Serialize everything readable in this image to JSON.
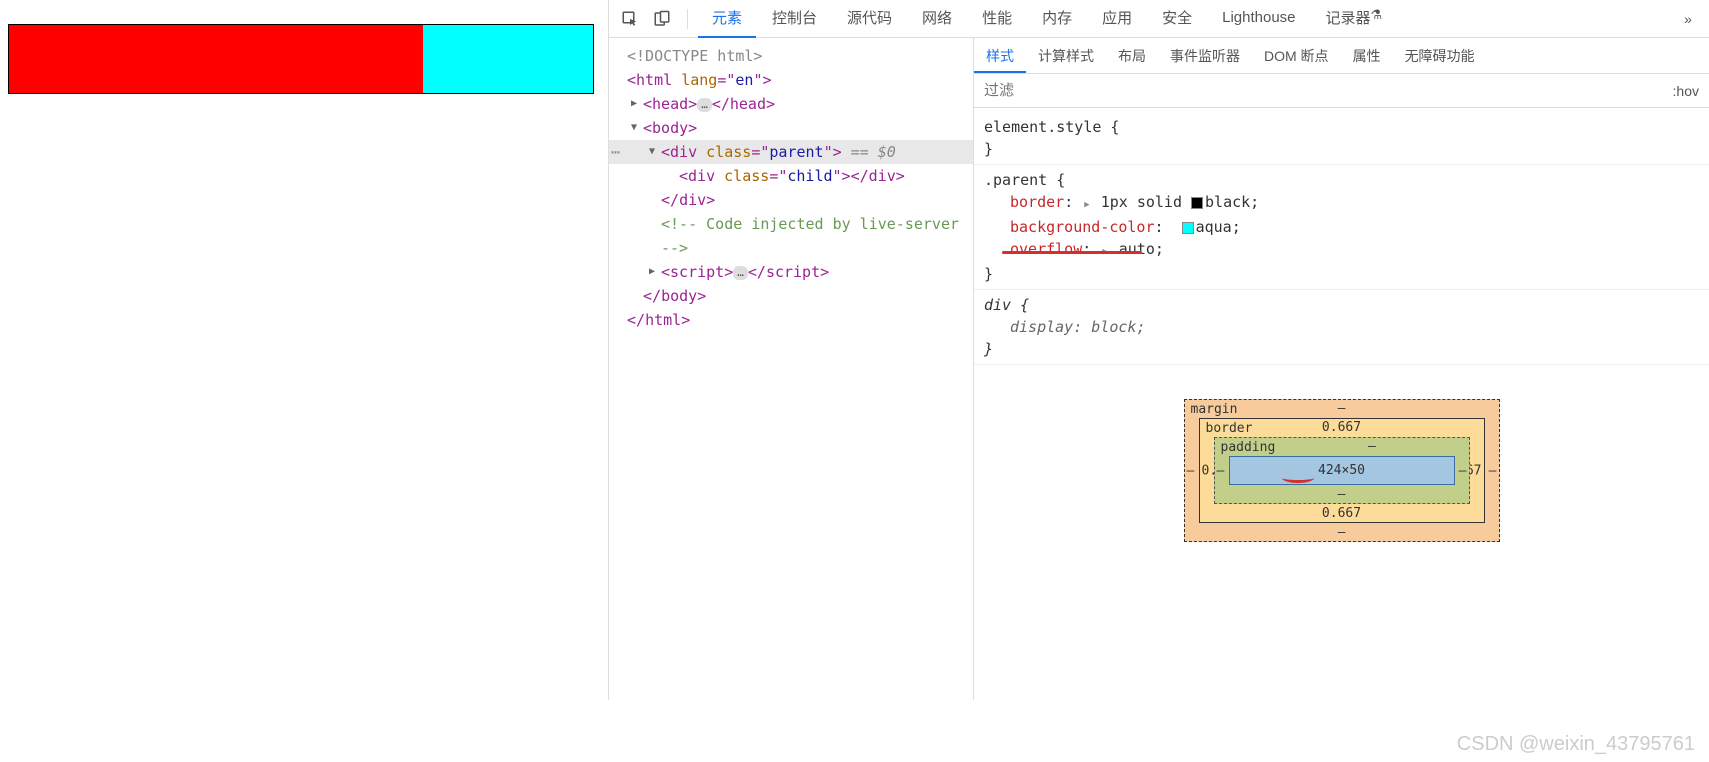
{
  "toolbar": {
    "tabs": [
      "元素",
      "控制台",
      "源代码",
      "网络",
      "性能",
      "内存",
      "应用",
      "安全",
      "Lighthouse"
    ],
    "recorder": "记录器",
    "active_tab": "元素"
  },
  "dom": {
    "doctype": "<!DOCTYPE html>",
    "html_open": "<html lang=\"en\">",
    "head_open": "<head>",
    "head_ellipsis": "…",
    "head_close": "</head>",
    "body_open": "<body>",
    "parent_open": "<div class=\"parent\">",
    "selected_suffix": " == $0",
    "child": "<div class=\"child\"></div>",
    "parent_close": "</div>",
    "comment_l1": "<!-- Code injected by live-server",
    "comment_l2": "-->",
    "script_open": "<script>",
    "script_ellipsis": "…",
    "script_close": "</script>",
    "body_close": "</body>",
    "html_close": "</html>"
  },
  "styles_tabs": [
    "样式",
    "计算样式",
    "布局",
    "事件监听器",
    "DOM 断点",
    "属性",
    "无障碍功能"
  ],
  "styles_active": "样式",
  "filter": {
    "placeholder": "过滤",
    "hov": ":hov"
  },
  "rules": {
    "element_style": {
      "selector": "element.style {",
      "close": "}"
    },
    "parent": {
      "selector": ".parent {",
      "p1": {
        "name": "border",
        "value": "1px solid ",
        "color_name": "black",
        "suffix": ";"
      },
      "p2": {
        "name": "background-color",
        "value": "",
        "color_name": "aqua",
        "suffix": ";"
      },
      "p3": {
        "name": "overflow",
        "value": "auto",
        "suffix": ";"
      },
      "close": "}"
    },
    "div": {
      "selector": "div {",
      "p1": {
        "name": "display",
        "value": "block",
        "suffix": ";"
      },
      "close": "}"
    }
  },
  "box_model": {
    "margin_label": "margin",
    "border_label": "border",
    "padding_label": "padding",
    "dash": "–",
    "border_val": "0.667",
    "content": "424×50"
  },
  "watermark": "CSDN @weixin_43795761"
}
